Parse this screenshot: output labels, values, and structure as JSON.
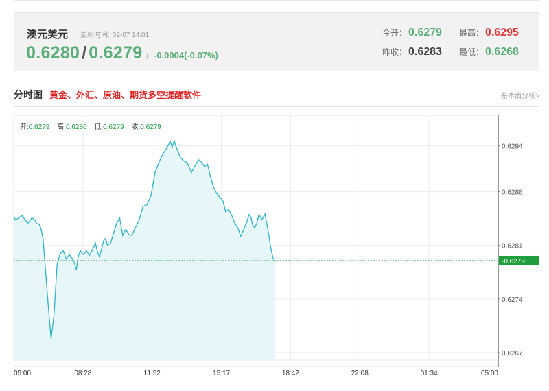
{
  "quote": {
    "name": "澳元美元",
    "update_label": "更新时间:",
    "update_time": "02-07 14:01",
    "bid": "0.6280",
    "slash": "/",
    "ask": "0.6279",
    "arrow": "↓",
    "change": "-0.0004(-0.07%)",
    "stats": {
      "open_label": "今开：",
      "open": "0.6279",
      "high_label": "最高：",
      "high": "0.6295",
      "prev_close_label": "昨收：",
      "prev_close": "0.6283",
      "low_label": "最低：",
      "low": "0.6268"
    }
  },
  "section": {
    "title": "分时图",
    "promo": "黄金、外汇、原油、期货多空提醒软件",
    "analysis_link": "基本面分析>"
  },
  "ohlc": {
    "open_label": "开:",
    "open": "0.6279",
    "high_label": "高:",
    "high": "0.6280",
    "low_label": "低:",
    "low": "0.6279",
    "close_label": "收:",
    "close": "0.6279"
  },
  "colors": {
    "line": "#2bb4c8",
    "area_fill": "#e6f6f9",
    "current_price": "#1e9e3c",
    "up": "#e4393c",
    "down": "#5cae78"
  },
  "chart_data": {
    "type": "area",
    "current_price": 0.6279,
    "y_ticks": [
      0.6294,
      0.6288,
      0.6281,
      0.6274,
      0.6267
    ],
    "ylim": [
      0.6266,
      0.6298
    ],
    "x_ticks": [
      "05:00",
      "08:28",
      "11:52",
      "15:17",
      "18:42",
      "22:08",
      "01:34",
      "05:00"
    ],
    "x_hours_elapsed": [
      0,
      0.1,
      0.4,
      0.7,
      0.9,
      1.05,
      1.15,
      1.25,
      1.35,
      1.45,
      1.55,
      1.7,
      1.85,
      2.0,
      2.15,
      2.3,
      2.45,
      2.6,
      2.75,
      2.9,
      3.0,
      3.1,
      3.2,
      3.3,
      3.45,
      3.6,
      3.75,
      3.9,
      4.05,
      4.15,
      4.25,
      4.35,
      4.45,
      4.55,
      4.65,
      4.8,
      4.95,
      5.1,
      5.25,
      5.4,
      5.55,
      5.7,
      5.85,
      6.0,
      6.2,
      6.4,
      6.6,
      6.8,
      7.0,
      7.2,
      7.4,
      7.6,
      7.75,
      7.85,
      7.95,
      8.05,
      8.15,
      8.25,
      8.4,
      8.6,
      8.8,
      9.0,
      9.15,
      9.3,
      9.45,
      9.6,
      9.75,
      9.9,
      10.05,
      10.2,
      10.35,
      10.5,
      10.65,
      10.8,
      10.95,
      11.1,
      11.25,
      11.4,
      11.55,
      11.65,
      11.75,
      11.85,
      11.95,
      12.05,
      12.15,
      12.3,
      12.45,
      12.6,
      12.75,
      12.85,
      12.95
    ],
    "values": [
      0.62848,
      0.62843,
      0.62849,
      0.62839,
      0.62846,
      0.62843,
      0.62838,
      0.62838,
      0.62832,
      0.62819,
      0.62786,
      0.62735,
      0.62688,
      0.6272,
      0.62785,
      0.62799,
      0.62803,
      0.62792,
      0.62798,
      0.62793,
      0.62787,
      0.62778,
      0.62796,
      0.62803,
      0.62798,
      0.62803,
      0.62797,
      0.62804,
      0.62813,
      0.62801,
      0.62795,
      0.62805,
      0.62816,
      0.62819,
      0.6281,
      0.62813,
      0.62826,
      0.62839,
      0.62846,
      0.62823,
      0.62831,
      0.62824,
      0.62823,
      0.62832,
      0.62842,
      0.62861,
      0.62863,
      0.62875,
      0.62905,
      0.62919,
      0.6293,
      0.62938,
      0.62946,
      0.62938,
      0.62947,
      0.62938,
      0.62932,
      0.62925,
      0.62921,
      0.62918,
      0.62905,
      0.62915,
      0.62922,
      0.62919,
      0.62913,
      0.62916,
      0.62899,
      0.62886,
      0.62878,
      0.62873,
      0.62869,
      0.62854,
      0.62857,
      0.62849,
      0.62839,
      0.62833,
      0.62822,
      0.62831,
      0.62841,
      0.6285,
      0.62847,
      0.62835,
      0.62833,
      0.6284,
      0.6285,
      0.62844,
      0.62851,
      0.62829,
      0.62804,
      0.62793,
      0.62789
    ],
    "x_range_hours": [
      0,
      24
    ],
    "grid": true
  }
}
